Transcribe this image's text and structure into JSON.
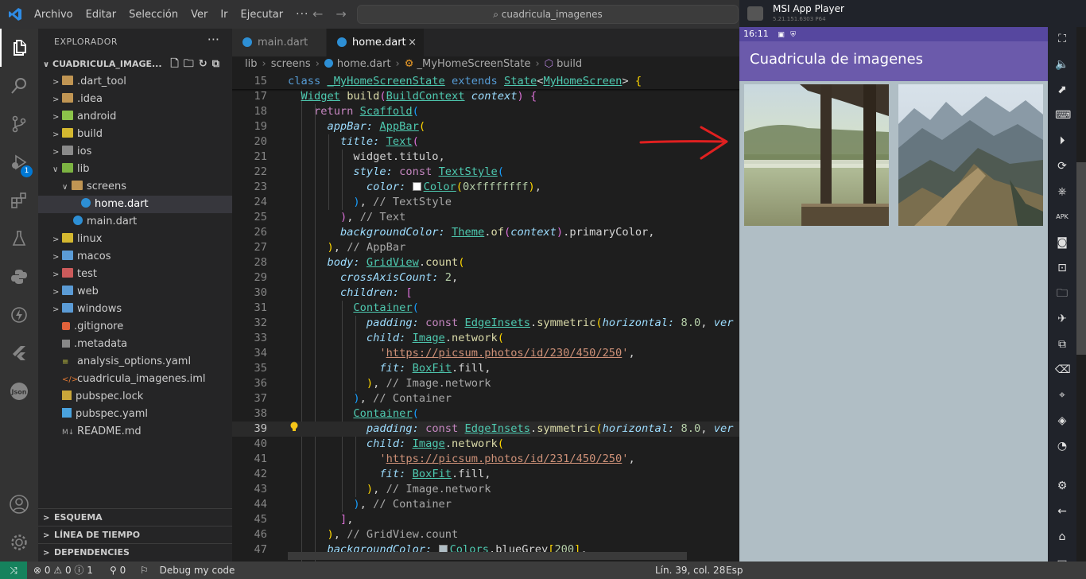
{
  "titlebar": {
    "menu": [
      "Archivo",
      "Editar",
      "Selección",
      "Ver",
      "Ir",
      "Ejecutar"
    ],
    "more": "···",
    "search": "cuadricula_imagenes"
  },
  "explorer": {
    "title": "EXPLORADOR",
    "more": "···",
    "project": "CUADRICULA_IMAGE...",
    "items": [
      {
        "label": ".dart_tool",
        "icon": "folder-icon"
      },
      {
        "label": ".idea",
        "icon": "folder-icon"
      },
      {
        "label": "android",
        "icon": "folder-icon"
      },
      {
        "label": "build",
        "icon": "folder-icon"
      },
      {
        "label": "ios",
        "icon": "folder-icon"
      },
      {
        "label": "lib",
        "icon": "folder-icon"
      },
      {
        "label": "screens",
        "icon": "folder-icon"
      },
      {
        "label": "home.dart",
        "icon": "dart-icon"
      },
      {
        "label": "main.dart",
        "icon": "dart-icon"
      },
      {
        "label": "linux",
        "icon": "folder-icon"
      },
      {
        "label": "macos",
        "icon": "folder-icon"
      },
      {
        "label": "test",
        "icon": "folder-icon"
      },
      {
        "label": "web",
        "icon": "folder-icon"
      },
      {
        "label": "windows",
        "icon": "folder-icon"
      },
      {
        "label": ".gitignore",
        "icon": "gitignore-icon"
      },
      {
        "label": ".metadata",
        "icon": "metadata-icon"
      },
      {
        "label": "analysis_options.yaml",
        "icon": "yaml-icon"
      },
      {
        "label": "cuadricula_imagenes.iml",
        "icon": "xml-icon"
      },
      {
        "label": "pubspec.lock",
        "icon": "lock-icon"
      },
      {
        "label": "pubspec.yaml",
        "icon": "yaml-icon"
      },
      {
        "label": "README.md",
        "icon": "markdown-icon"
      }
    ],
    "sections": [
      "ESQUEMA",
      "LÍNEA DE TIEMPO",
      "DEPENDENCIES"
    ]
  },
  "editor": {
    "tabs": [
      {
        "label": "main.dart",
        "active": false
      },
      {
        "label": "home.dart",
        "active": true
      }
    ],
    "close": "×",
    "breadcrumb": [
      "lib",
      "screens",
      "home.dart",
      "_MyHomeScreenState",
      "build"
    ],
    "line_numbers": [
      "15",
      "17",
      "18",
      "19",
      "20",
      "21",
      "22",
      "23",
      "24",
      "25",
      "26",
      "27",
      "28",
      "29",
      "30",
      "31",
      "32",
      "33",
      "34",
      "35",
      "36",
      "37",
      "38",
      "39",
      "40",
      "41",
      "42",
      "43",
      "44",
      "45",
      "46",
      "47"
    ],
    "current_line": "39"
  },
  "statusbar": {
    "errors": "0",
    "warnings": "0",
    "info": "1",
    "ports": "0",
    "debug": "Debug my code",
    "position": "Lín. 39, col. 28",
    "spaces": "Esp"
  },
  "emulator": {
    "app_name": "MSI App Player",
    "version": "5.21.151.6303  P64",
    "time": "16:11",
    "appbar_title": "Cuadricula de imagenes",
    "background_color": "#b0bec5",
    "appbar_color": "#6b5aab"
  }
}
